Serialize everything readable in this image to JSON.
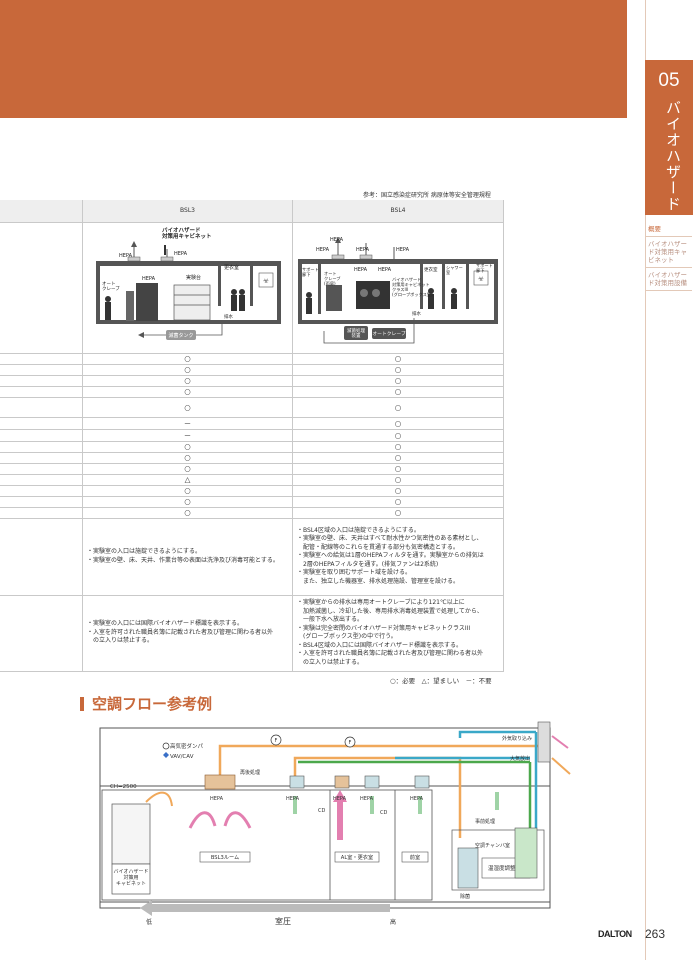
{
  "section": {
    "number": "05",
    "title": "バイオハザード"
  },
  "side_nav": [
    "概要",
    "バイオハザード対策用キャビネット",
    "バイオハザード対策用設備"
  ],
  "source_note": "参考：国立感染症研究所 病原体等安全管理規程",
  "table": {
    "headers": [
      "",
      "BSL3",
      "BSL4"
    ],
    "rows": [
      [
        "○",
        "○"
      ],
      [
        "○",
        "○"
      ],
      [
        "○",
        "○"
      ],
      [
        "○",
        "○"
      ],
      [
        "○",
        "○"
      ],
      [
        "－",
        "○"
      ],
      [
        "－",
        "○"
      ],
      [
        "○",
        "○"
      ],
      [
        "○",
        "○"
      ],
      [
        "○",
        "○"
      ],
      [
        "△",
        "○"
      ],
      [
        "○",
        "○"
      ],
      [
        "○",
        "○"
      ],
      [
        "○",
        "○"
      ]
    ],
    "structure_bsl3": "・実験室の入口は施錠できるようにする。\n・実験室の壁、床、天井、作業台等の表面は洗浄及び消毒可能とする。",
    "structure_bsl4": "・BSL4区域の入口は施錠できるようにする。\n・実験室の壁、床、天井はすべて耐水性かつ気密性のある素材とし、\n　配管・配線等のこれらを貫通する部分も気密構造とする。\n・実験室への給気は1層のHEPAフィルタを通す。実験室からの排気は\n　2層のHEPAフィルタを通す。(排気ファンは2系統)\n・実験室を取り囲むサポート域を設ける。\n　また、独立した機器室、排水処理施設、管理室を設ける。",
    "operation_bsl3": "・実験室の入口には国際バイオハザード標識を表示する。\n・入室を許可された職員名簿に記載された者及び管理に関わる者以外\n　の立入りは禁止する。",
    "operation_bsl4": "・実験室からの排水は専用オートクレーブにより121℃以上に\n　加熱滅菌し、冷却した後、専用排水消毒処理装置で処理してから、\n　一般下水へ放出する。\n・実験は完全密閉のバイオハザード対策用キャビネットクラスIII\n　(グローブボックス型)の中で行う。\n・BSL4区域の入口には国際バイオハザード標識を表示する。\n・入室を許可された職員名簿に記載された者及び管理に関わる者以外\n　の立入りは禁止する。"
  },
  "bsl3_diagram": {
    "cabinet_label": "バイオハザード\n対策用キャビネット",
    "hepa": "HEPA",
    "autoclave": "オート\nクレーブ",
    "bench": "実験台",
    "locker": "更衣室",
    "drain": "排水",
    "tank": "滅菌タンク"
  },
  "bsl4_diagram": {
    "hepa": "HEPA",
    "support_corridor": "サポート\n廊下",
    "autoclave": "オート\nクレーブ\n(両扉)",
    "cabinet_label": "バイオハザード\n対策用キャビネット\nクラスIII\n(グローブボックス型)",
    "locker": "更衣室",
    "shower": "シャワー\n室",
    "drain": "排水",
    "drain_treatment": "滅菌処理\n装置",
    "autoclave2": "オートクレーブ"
  },
  "legend": "○：必要　△：望ましい　－：不要",
  "heading": "空調フロー参考例",
  "flow": {
    "damper_legend": "高気密ダンパ",
    "vav_legend": "VAV/CAV",
    "outdoor_intake": "外気取り込み",
    "exhaust": "大気放出",
    "ch": "CH=2500",
    "post_treatment": "再後処理",
    "pre_treatment": "事前処理",
    "chamber": "空調チャンバ室",
    "temp_control": "温湿度調整",
    "humidifier": "除菌",
    "hepa": "HEPA",
    "cd": "CD",
    "rooms": [
      "BSL3ルーム",
      "AL室・更衣室",
      "前室"
    ],
    "cabinet": "バイオハザード\n対策用\nキャビネット",
    "pressure_label": "室圧",
    "pressure_low": "低",
    "pressure_high": "高",
    "fan": "F"
  },
  "brand": "DALTON",
  "page_number": "263",
  "colors": {
    "accent": "#c8683a",
    "supply": "#f0a85a",
    "exhaust": "#3aa8c8",
    "return": "#4ca84c",
    "pink": "#e37fb0"
  }
}
